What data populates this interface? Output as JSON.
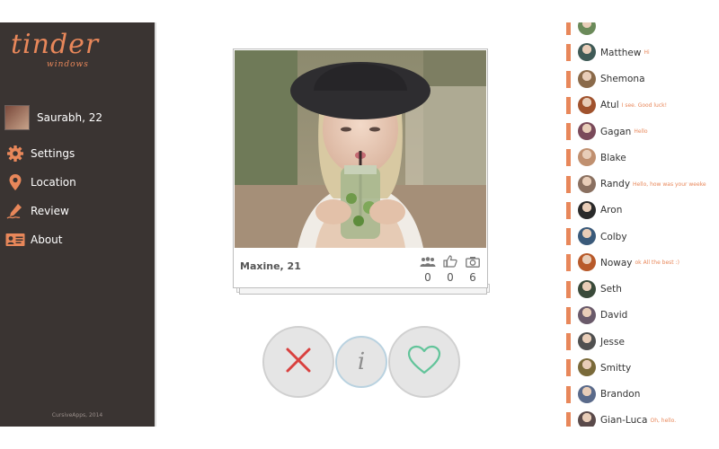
{
  "app": {
    "logo_text": "tinder",
    "logo_sub": "windows",
    "copyright": "CursiveApps, 2014"
  },
  "profile": {
    "name": "Saurabh, 22"
  },
  "menu": [
    {
      "label": "Settings",
      "icon": "gear-icon"
    },
    {
      "label": "Location",
      "icon": "location-pin-icon"
    },
    {
      "label": "Review",
      "icon": "pen-icon"
    },
    {
      "label": "About",
      "icon": "id-card-icon"
    }
  ],
  "card": {
    "name": "Maxine, 21",
    "stats": [
      {
        "icon": "friends-icon",
        "value": "0"
      },
      {
        "icon": "thumbs-up-icon",
        "value": "0"
      },
      {
        "icon": "camera-icon",
        "value": "6"
      }
    ]
  },
  "actions": {
    "nope_icon": "x-icon",
    "info_icon": "info-icon",
    "info_glyph": "i",
    "like_icon": "heart-icon"
  },
  "colors": {
    "accent": "#e8875a",
    "sidebar_bg": "#3a3432",
    "nope": "#d9413f",
    "like": "#62c49a"
  },
  "matches": [
    {
      "name": "",
      "message": ""
    },
    {
      "name": "Matthew",
      "message": "Hi"
    },
    {
      "name": "Shemona",
      "message": ""
    },
    {
      "name": "Atul",
      "message": "I see. Good luck!"
    },
    {
      "name": "Gagan",
      "message": "Hello"
    },
    {
      "name": "Blake",
      "message": ""
    },
    {
      "name": "Randy",
      "message": "Hello, how was your weeke"
    },
    {
      "name": "Aron",
      "message": ""
    },
    {
      "name": "Colby",
      "message": ""
    },
    {
      "name": "Noway",
      "message": "ok All the best :)"
    },
    {
      "name": "Seth",
      "message": ""
    },
    {
      "name": "David",
      "message": ""
    },
    {
      "name": "Jesse",
      "message": ""
    },
    {
      "name": "Smitty",
      "message": ""
    },
    {
      "name": "Brandon",
      "message": ""
    },
    {
      "name": "Gian-Luca",
      "message": "Oh, hello."
    }
  ]
}
